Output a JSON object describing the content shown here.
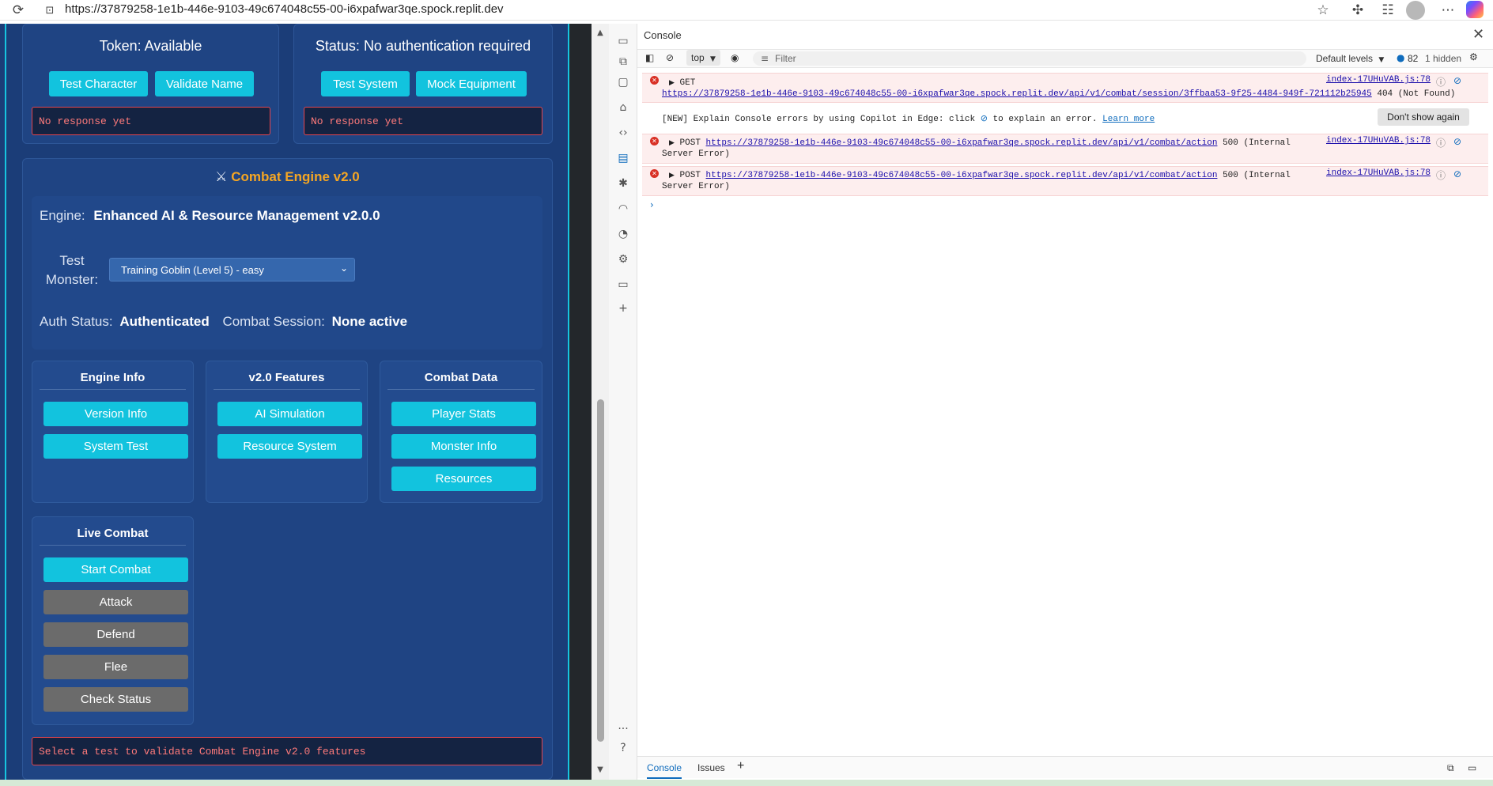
{
  "browser": {
    "url": "https://37879258-1e1b-446e-9103-49c674048c55-00-i6xpafwar3qe.spock.replit.dev"
  },
  "left_app": {
    "token_panel": {
      "title": "Token: Available",
      "buttons": [
        "Test Character",
        "Validate Name"
      ],
      "response": "No response yet"
    },
    "status_panel": {
      "title": "Status: No authentication required",
      "buttons": [
        "Test System",
        "Mock Equipment"
      ],
      "response": "No response yet"
    },
    "combat_engine": {
      "icon": "⚔",
      "title": "Combat Engine v2.0",
      "title_color": "#f5a623",
      "engine_label": "Engine:",
      "engine_value": "Enhanced AI & Resource Management v2.0.0",
      "monster_label_1": "Test",
      "monster_label_2": "Monster:",
      "monster_selected": "Training Goblin (Level 5) - easy",
      "auth_label": "Auth Status:",
      "auth_value": "Authenticated",
      "session_label": "Combat Session:",
      "session_value": "None active",
      "sections": {
        "engine_info": {
          "title": "Engine Info",
          "buttons": [
            "Version Info",
            "System Test"
          ]
        },
        "features": {
          "title": "v2.0 Features",
          "buttons": [
            "AI Simulation",
            "Resource System"
          ]
        },
        "combat_data": {
          "title": "Combat Data",
          "buttons": [
            "Player Stats",
            "Monster Info",
            "Resources"
          ]
        },
        "live_combat": {
          "title": "Live Combat",
          "buttons": [
            "Start Combat",
            "Attack",
            "Defend",
            "Flee",
            "Check Status"
          ]
        }
      },
      "result_text": "Select a test to validate Combat Engine v2.0 features"
    }
  },
  "devtools": {
    "panel_title": "Console",
    "context": "top",
    "filter_placeholder": "Filter",
    "default_levels": "Default levels",
    "message_count": "82",
    "hidden": "1 hidden",
    "messages": [
      {
        "method": "GET",
        "url": "https://37879258-1e1b-446e-9103-49c674048c55-00-i6xpafwar3qe.spock.replit.dev/api/v1/combat/session/3ffbaa53-9f25-4484-949f-721112b25945",
        "status": "404 (Not Found)",
        "source": "index-17UHuVAB.js:78"
      },
      {
        "info_prefix": "[NEW] Explain Console errors by using Copilot in Edge: click",
        "info_suffix": "to explain an error.",
        "learn_more": "Learn more",
        "dismiss": "Don't show again"
      },
      {
        "method": "POST",
        "url": "https://37879258-1e1b-446e-9103-49c674048c55-00-i6xpafwar3qe.spock.replit.dev/api/v1/combat/action",
        "status": "500 (Internal",
        "status_cont": "Server Error)",
        "source": "index-17UHuVAB.js:78"
      },
      {
        "method": "POST",
        "url": "https://37879258-1e1b-446e-9103-49c674048c55-00-i6xpafwar3qe.spock.replit.dev/api/v1/combat/action",
        "status": "500 (Internal",
        "status_cont": "Server Error)",
        "source": "index-17UHuVAB.js:78"
      }
    ],
    "bottom_tabs": [
      "Console",
      "Issues"
    ],
    "more": "..."
  }
}
